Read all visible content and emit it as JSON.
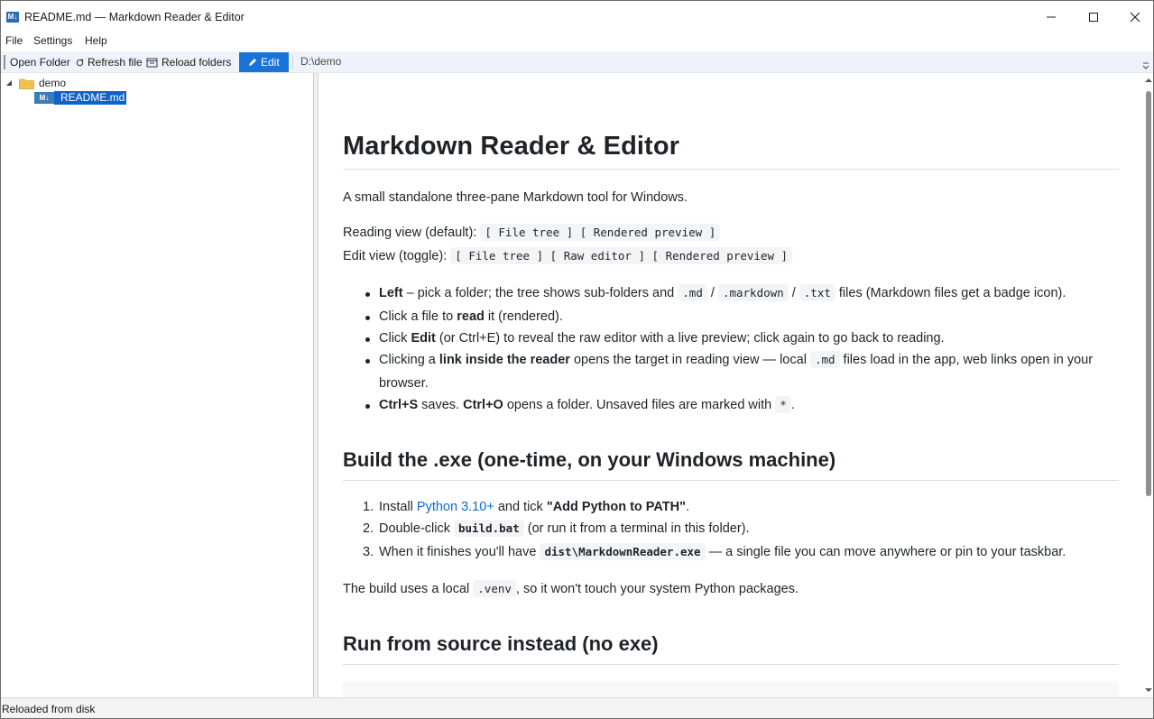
{
  "window": {
    "title": "README.md — Markdown Reader & Editor",
    "icon_text": "M↓"
  },
  "menu": [
    "File",
    "Settings",
    "Help"
  ],
  "toolbar": {
    "open_folder": "Open Folder",
    "refresh_file": "Refresh file",
    "reload_folders": "Reload folders",
    "edit": "Edit",
    "path": "D:\\demo"
  },
  "tree": {
    "folder": "demo",
    "file": "README.md",
    "file_icon_text": "M↓"
  },
  "doc": {
    "h1": "Markdown Reader & Editor",
    "intro": "A small standalone three-pane Markdown tool for Windows.",
    "reading_label": "Reading view (default):",
    "reading_code": "[ File tree ] [ Rendered preview ]",
    "edit_label": "Edit view (toggle):",
    "edit_code": "[ File tree ] [ Raw editor ] [ Rendered preview ]",
    "bullets": {
      "b1_bold": "Left",
      "b1_text1": " – pick a folder; the tree shows sub-folders and ",
      "b1_code1": ".md",
      "b1_slash1": " / ",
      "b1_code2": ".markdown",
      "b1_slash2": " / ",
      "b1_code3": ".txt",
      "b1_text2": " files (Markdown files get a badge icon).",
      "b2_text1": "Click a file to ",
      "b2_bold": "read",
      "b2_text2": " it (rendered).",
      "b3_text1": "Click ",
      "b3_bold": "Edit",
      "b3_text2": " (or Ctrl+E) to reveal the raw editor with a live preview; click again to go back to reading.",
      "b4_text1": "Clicking a ",
      "b4_bold": "link inside the reader",
      "b4_text2": " opens the target in reading view — local ",
      "b4_code": ".md",
      "b4_text3": " files load in the app, web links open in your",
      "b4_text4": "browser.",
      "b5_bold1": "Ctrl+S",
      "b5_text1": " saves. ",
      "b5_bold2": "Ctrl+O",
      "b5_text2": " opens a folder. Unsaved files are marked with ",
      "b5_code": "*",
      "b5_text3": "."
    },
    "h2_build": "Build the .exe (one-time, on your Windows machine)",
    "steps": {
      "s1_num": "1.",
      "s1_text1": "Install ",
      "s1_link": "Python 3.10+",
      "s1_text2": " and tick ",
      "s1_bold": "\"Add Python to PATH\"",
      "s1_text3": ".",
      "s2_num": "2.",
      "s2_text1": "Double-click ",
      "s2_code": "build.bat",
      "s2_text2": " (or run it from a terminal in this folder).",
      "s3_num": "3.",
      "s3_text1": "When it finishes you'll have ",
      "s3_code": "dist\\MarkdownReader.exe",
      "s3_text2": " — a single file you can move anywhere or pin to your taskbar."
    },
    "venv_text1": "The build uses a local ",
    "venv_code": ".venv",
    "venv_text2": ", so it won't touch your system Python packages.",
    "h2_run": "Run from source instead (no exe)"
  },
  "status": "Reloaded from disk"
}
